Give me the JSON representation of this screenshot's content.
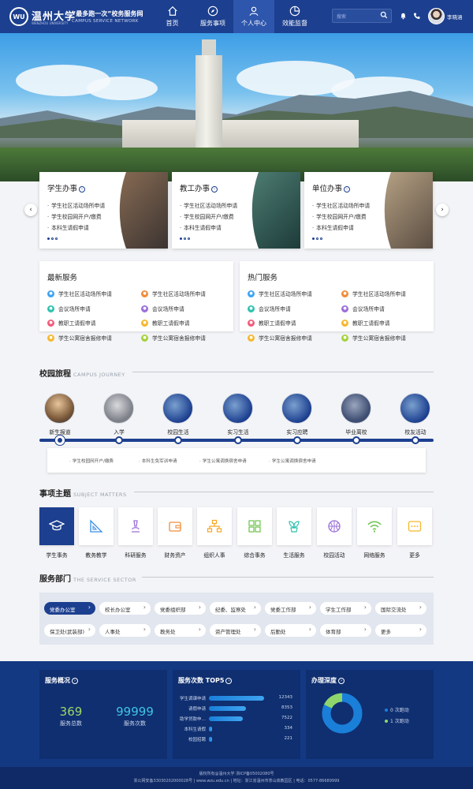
{
  "header": {
    "logo_seal": "WU",
    "logo_name": "温州大学",
    "logo_en": "WENZHOU UNIVERSITY",
    "slogan": "“最多跑一次”校务服务网",
    "slogan_en": "CAMPUS SERVICE NETWORK",
    "nav": [
      {
        "label": "首页",
        "icon": "home-icon"
      },
      {
        "label": "服务事项",
        "icon": "compass-icon"
      },
      {
        "label": "个人中心",
        "icon": "user-icon",
        "active": true
      },
      {
        "label": "效能监督",
        "icon": "pie-chart-icon"
      }
    ],
    "search_placeholder": "搜索",
    "username": "李晓涵"
  },
  "cards": [
    {
      "title": "学生办事",
      "items": [
        "学生社区活动场所申请",
        "学生校园网开户/缴费",
        "本科生请假申请"
      ]
    },
    {
      "title": "教工办事",
      "items": [
        "学生社区活动场所申请",
        "学生校园网开户/缴费",
        "本科生请假申请"
      ]
    },
    {
      "title": "单位办事",
      "items": [
        "学生社区活动场所申请",
        "学生校园网开户/缴费",
        "本科生请假申请"
      ]
    }
  ],
  "latest": {
    "title": "最新服务",
    "items": [
      "学生社区活动场所申请",
      "学生社区活动场所申请",
      "会议场所申请",
      "会议场所申请",
      "教职工请假申请",
      "教职工请假申请",
      "学生公寓宿舍报修申请",
      "学生公寓宿舍报修申请"
    ]
  },
  "hot": {
    "title": "热门服务",
    "items": [
      "学生社区活动场所申请",
      "学生社区活动场所申请",
      "会议场所申请",
      "会议场所申请",
      "教职工请假申请",
      "教职工请假申请",
      "学生公寓宿舍报修申请",
      "学生公寓宿舍报修申请"
    ]
  },
  "journey": {
    "title": "校园旅程",
    "title_en": "CAMPUS JOURNEY",
    "stages": [
      "新生报道",
      "入学",
      "校园生活",
      "实习生活",
      "实习应聘",
      "毕业离校",
      "校友活动"
    ],
    "sub_items": [
      "学生校园网开户/缴费",
      "本科生免军训申请",
      "学生公寓调换宿舍申请",
      "学生公寓调换宿舍申请"
    ]
  },
  "subjects": {
    "title": "事项主题",
    "title_en": "SUBJECT MATTERS",
    "items": [
      {
        "label": "学生事务",
        "icon": "graduation-cap-icon"
      },
      {
        "label": "教务教学",
        "icon": "ruler-triangle-icon"
      },
      {
        "label": "科研服务",
        "icon": "microscope-icon"
      },
      {
        "label": "财务资产",
        "icon": "wallet-icon"
      },
      {
        "label": "组织人事",
        "icon": "org-chart-icon"
      },
      {
        "label": "综合事务",
        "icon": "grid-icon"
      },
      {
        "label": "生活服务",
        "icon": "plant-icon"
      },
      {
        "label": "校园活动",
        "icon": "basketball-icon"
      },
      {
        "label": "网络服务",
        "icon": "wifi-icon"
      },
      {
        "label": "更多",
        "icon": "more-icon"
      }
    ]
  },
  "departments": {
    "title": "服务部门",
    "title_en": "THE SERVICE SECTOR",
    "items": [
      "党委办公室",
      "校长办公室",
      "党委组织部",
      "纪委、监察处",
      "党委工作部",
      "学生工作部",
      "国际交流处",
      "保卫处(武装部)",
      "人事处",
      "教务处",
      "资产管理处",
      "后勤处",
      "体育部",
      "更多"
    ]
  },
  "overview": {
    "title": "服务概况",
    "total_services": "369",
    "total_services_label": "服务总数",
    "service_count": "99999",
    "service_count_label": "服务次数"
  },
  "top5": {
    "title": "服务次数 TOP5",
    "rows": [
      {
        "name": "学生调课申请",
        "value": 12343
      },
      {
        "name": "请假申请",
        "value": 8353
      },
      {
        "name": "助学贷款申…",
        "value": 7522
      },
      {
        "name": "本科生请假",
        "value": 334
      },
      {
        "name": "校园招聘",
        "value": 221
      }
    ]
  },
  "depth": {
    "title": "办理深度",
    "legend": [
      {
        "label": "0 次跑动",
        "color": "#1a7fd9",
        "value": 0.82
      },
      {
        "label": "1 次跑动",
        "color": "#8ed66c",
        "value": 0.18
      }
    ]
  },
  "footer": {
    "line1": "版权所有@温州大学 浙ICP备05002080号",
    "line2": "浙公网安备33030202000028号 | www.wzu.edu.cn | 地址：浙江省温州市茶山高教园区 | 电话：0577-86689999"
  },
  "colors": {
    "brand": "#1c3f8f",
    "accent": "#3fa4f0",
    "green": "#8ed66c"
  }
}
